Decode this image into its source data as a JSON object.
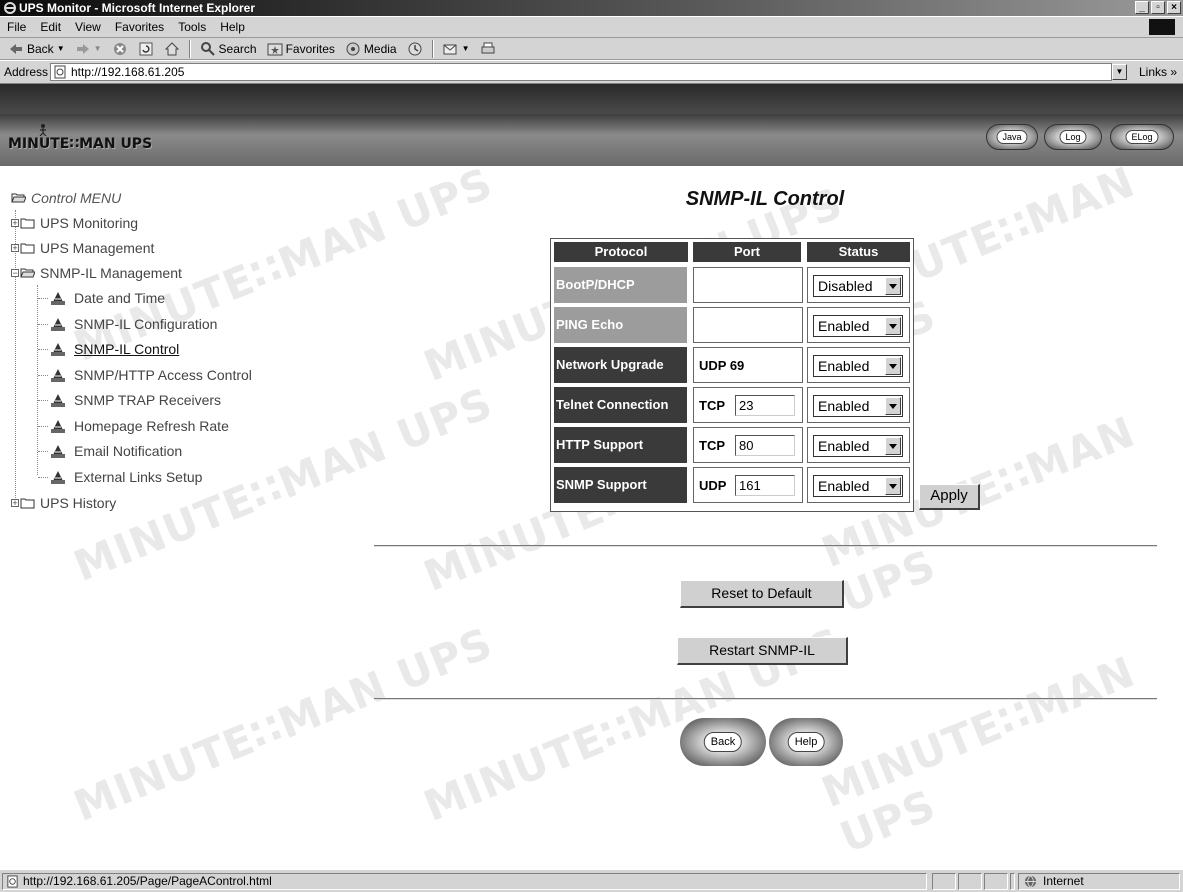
{
  "window": {
    "title": "UPS Monitor - Microsoft Internet Explorer",
    "controls": [
      "_",
      "\b",
      "x"
    ]
  },
  "menubar": [
    "File",
    "Edit",
    "View",
    "Favorites",
    "Tools",
    "Help"
  ],
  "toolbar": {
    "back": "Back",
    "search": "Search",
    "favorites": "Favorites",
    "media": "Media"
  },
  "address": {
    "label": "Address",
    "url": "http://192.168.61.205",
    "links": "Links »"
  },
  "banner": {
    "logo": "MINUTE∷MAN UPS",
    "buttons": [
      "Java",
      "Log",
      "ELog"
    ]
  },
  "watermark": "MINUTE∷MAN UPS",
  "tree": {
    "root": "Control MENU",
    "folders": [
      "UPS Monitoring",
      "UPS Management",
      "SNMP-IL Management",
      "UPS History"
    ],
    "items": [
      "Date and Time",
      "SNMP-IL Configuration",
      "SNMP-IL Control",
      "SNMP/HTTP Access Control",
      "SNMP TRAP Receivers",
      "Homepage Refresh Rate",
      "Email Notification",
      "External Links Setup"
    ]
  },
  "main": {
    "title": "SNMP-IL Control",
    "headers": [
      "Protocol",
      "Port",
      "Status"
    ],
    "rows": [
      {
        "protocol": "BootP/DHCP",
        "port_type": "",
        "port_value": "",
        "status": "Disabled",
        "editable": false
      },
      {
        "protocol": "PING Echo",
        "port_type": "",
        "port_value": "",
        "status": "Enabled",
        "editable": false
      },
      {
        "protocol": "Network Upgrade",
        "port_type": "UDP 69",
        "port_value": "",
        "status": "Enabled",
        "editable": false
      },
      {
        "protocol": "Telnet Connection",
        "port_type": "TCP",
        "port_value": "23",
        "status": "Enabled",
        "editable": true
      },
      {
        "protocol": "HTTP Support",
        "port_type": "TCP",
        "port_value": "80",
        "status": "Enabled",
        "editable": true
      },
      {
        "protocol": "SNMP Support",
        "port_type": "UDP",
        "port_value": "161",
        "status": "Enabled",
        "editable": true
      }
    ],
    "apply": "Apply",
    "reset": "Reset to Default",
    "restart": "Restart SNMP-IL",
    "back": "Back",
    "help": "Help"
  },
  "statusbar": {
    "url": "http://192.168.61.205/Page/PageAControl.html",
    "zone": "Internet"
  }
}
